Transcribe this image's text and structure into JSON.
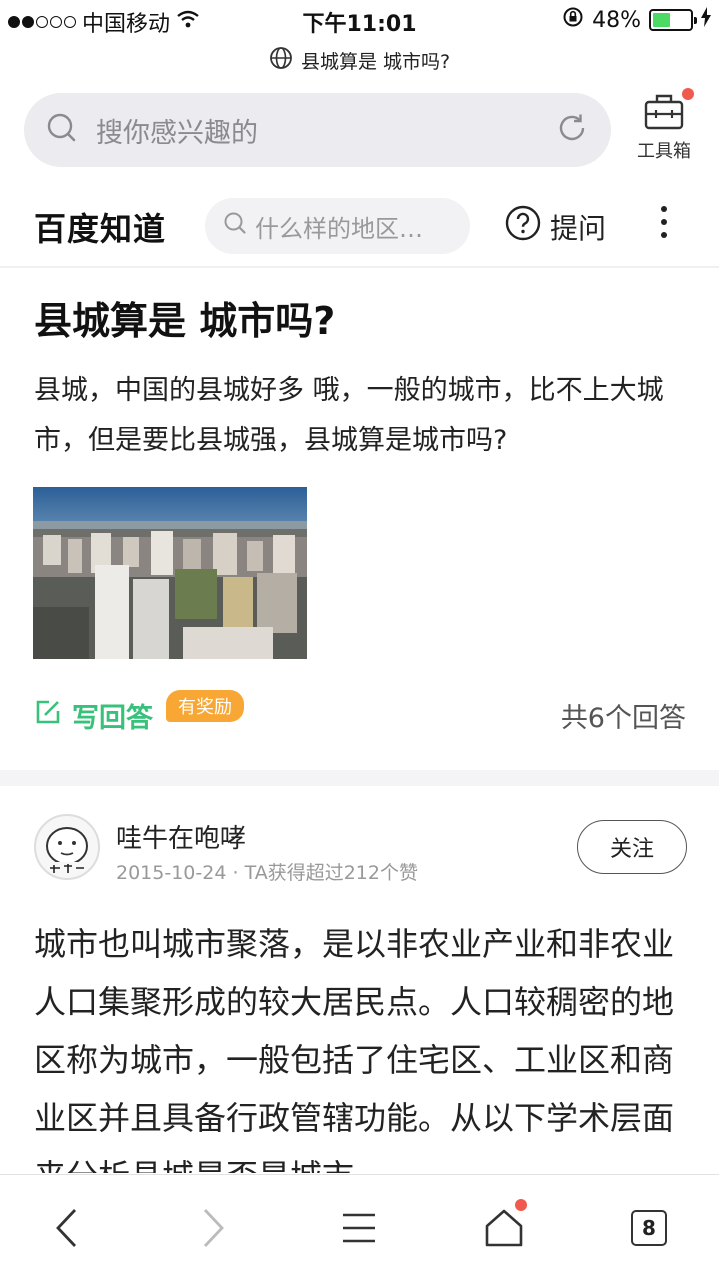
{
  "status_bar": {
    "carrier": "中国移动",
    "time": "下午11:01",
    "battery": "48%",
    "battery_level": 0.48,
    "signal_bars": 2,
    "signal_total": 5
  },
  "url_bar": {
    "title": "县城算是 城市吗?"
  },
  "search": {
    "placeholder": "搜你感兴趣的"
  },
  "toolbox": {
    "label": "工具箱"
  },
  "zhidao": {
    "logo": "百度知道",
    "search_placeholder": "什么样的地区…",
    "ask_label": "提问"
  },
  "question": {
    "title": "县城算是 城市吗?",
    "body": "县城，中国的县城好多 哦，一般的城市，比不上大城市，但是要比县城强，县城算是城市吗?",
    "write_answer": "写回答",
    "reward_badge": "有奖励",
    "answer_count": "共6个回答"
  },
  "answer": {
    "author": "哇牛在咆哮",
    "date": "2015-10-24",
    "meta_separator": "·",
    "likes": "TA获得超过212个赞",
    "follow_label": "关注",
    "body": "城市也叫城市聚落，是以非农业产业和非农业人口集聚形成的较大居民点。人口较稠密的地区称为城市，一般包括了住宅区、工业区和商业区并且具备行政管辖功能。从以下学术层面来分析县城是否是城市"
  },
  "bottom_bar": {
    "tab_count": "8"
  },
  "colors": {
    "accent_green": "#38c17a",
    "reward_orange": "#f8a734",
    "notify_red": "#f05a4e",
    "battery_green": "#4cd964"
  },
  "icons": {
    "status": [
      "wifi-icon",
      "rotation-lock-icon",
      "battery-icon",
      "charging-icon"
    ],
    "url": "globe-icon",
    "search": [
      "search-icon",
      "refresh-icon"
    ],
    "toolbox": "toolbox-icon",
    "zhidao": [
      "search-icon",
      "question-circle-icon",
      "more-vertical-icon"
    ],
    "write": "edit-icon",
    "bottom": [
      "back-icon",
      "forward-icon",
      "menu-icon",
      "home-icon",
      "tabs-icon"
    ]
  }
}
